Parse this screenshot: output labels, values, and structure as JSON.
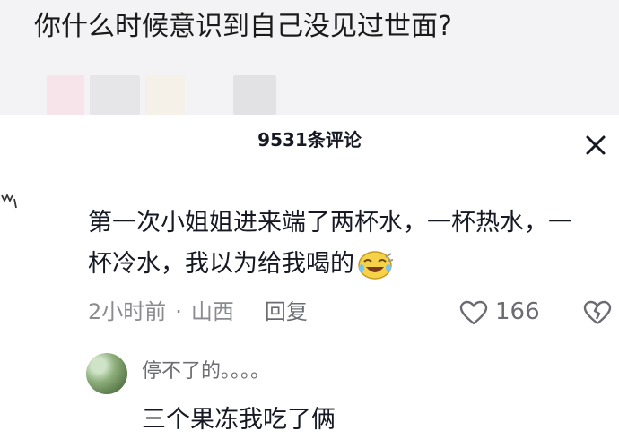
{
  "post": {
    "question": "你什么时候意识到自己没见过世面?"
  },
  "comments_sheet": {
    "count_label": "9531条评论",
    "close_icon": "close-icon"
  },
  "comment": {
    "text": "第一次小姐姐进来端了两杯水，一杯热水，一杯冷水，我以为给我喝的",
    "emoji": "crying-laughing-emoji-icon",
    "time": "2小时前",
    "separator": "·",
    "location": "山西",
    "reply_label": "回复",
    "likes": "166"
  },
  "sub_comment": {
    "author": "停不了的。。。。",
    "text": "三个果冻我吃了俩"
  },
  "colors": {
    "text_primary": "#161823",
    "text_secondary": "#8a8b91",
    "top_band": "#f3f3f5"
  }
}
